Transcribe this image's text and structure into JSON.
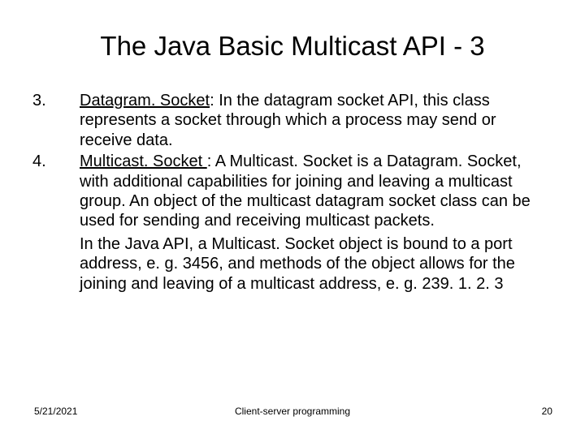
{
  "title": "The Java Basic Multicast API - 3",
  "items": [
    {
      "num": "3.",
      "term": "Datagram. Socket",
      "rest": ": In the datagram socket API, this class represents a socket through which a process may send or receive data."
    },
    {
      "num": "4.",
      "term": "Multicast. Socket ",
      "rest": ": A Multicast. Socket is a Datagram. Socket, with additional capabilities for joining and leaving a multicast group.  An object of the multicast datagram socket class can be used for sending and receiving multicast packets."
    }
  ],
  "continuation": "In the Java API, a Multicast. Socket object is bound to a port address, e. g. 3456, and methods of the object allows for the joining and leaving of a multicast address, e. g. 239. 1. 2. 3",
  "footer": {
    "date": "5/21/2021",
    "title": "Client-server programming",
    "page": "20"
  }
}
